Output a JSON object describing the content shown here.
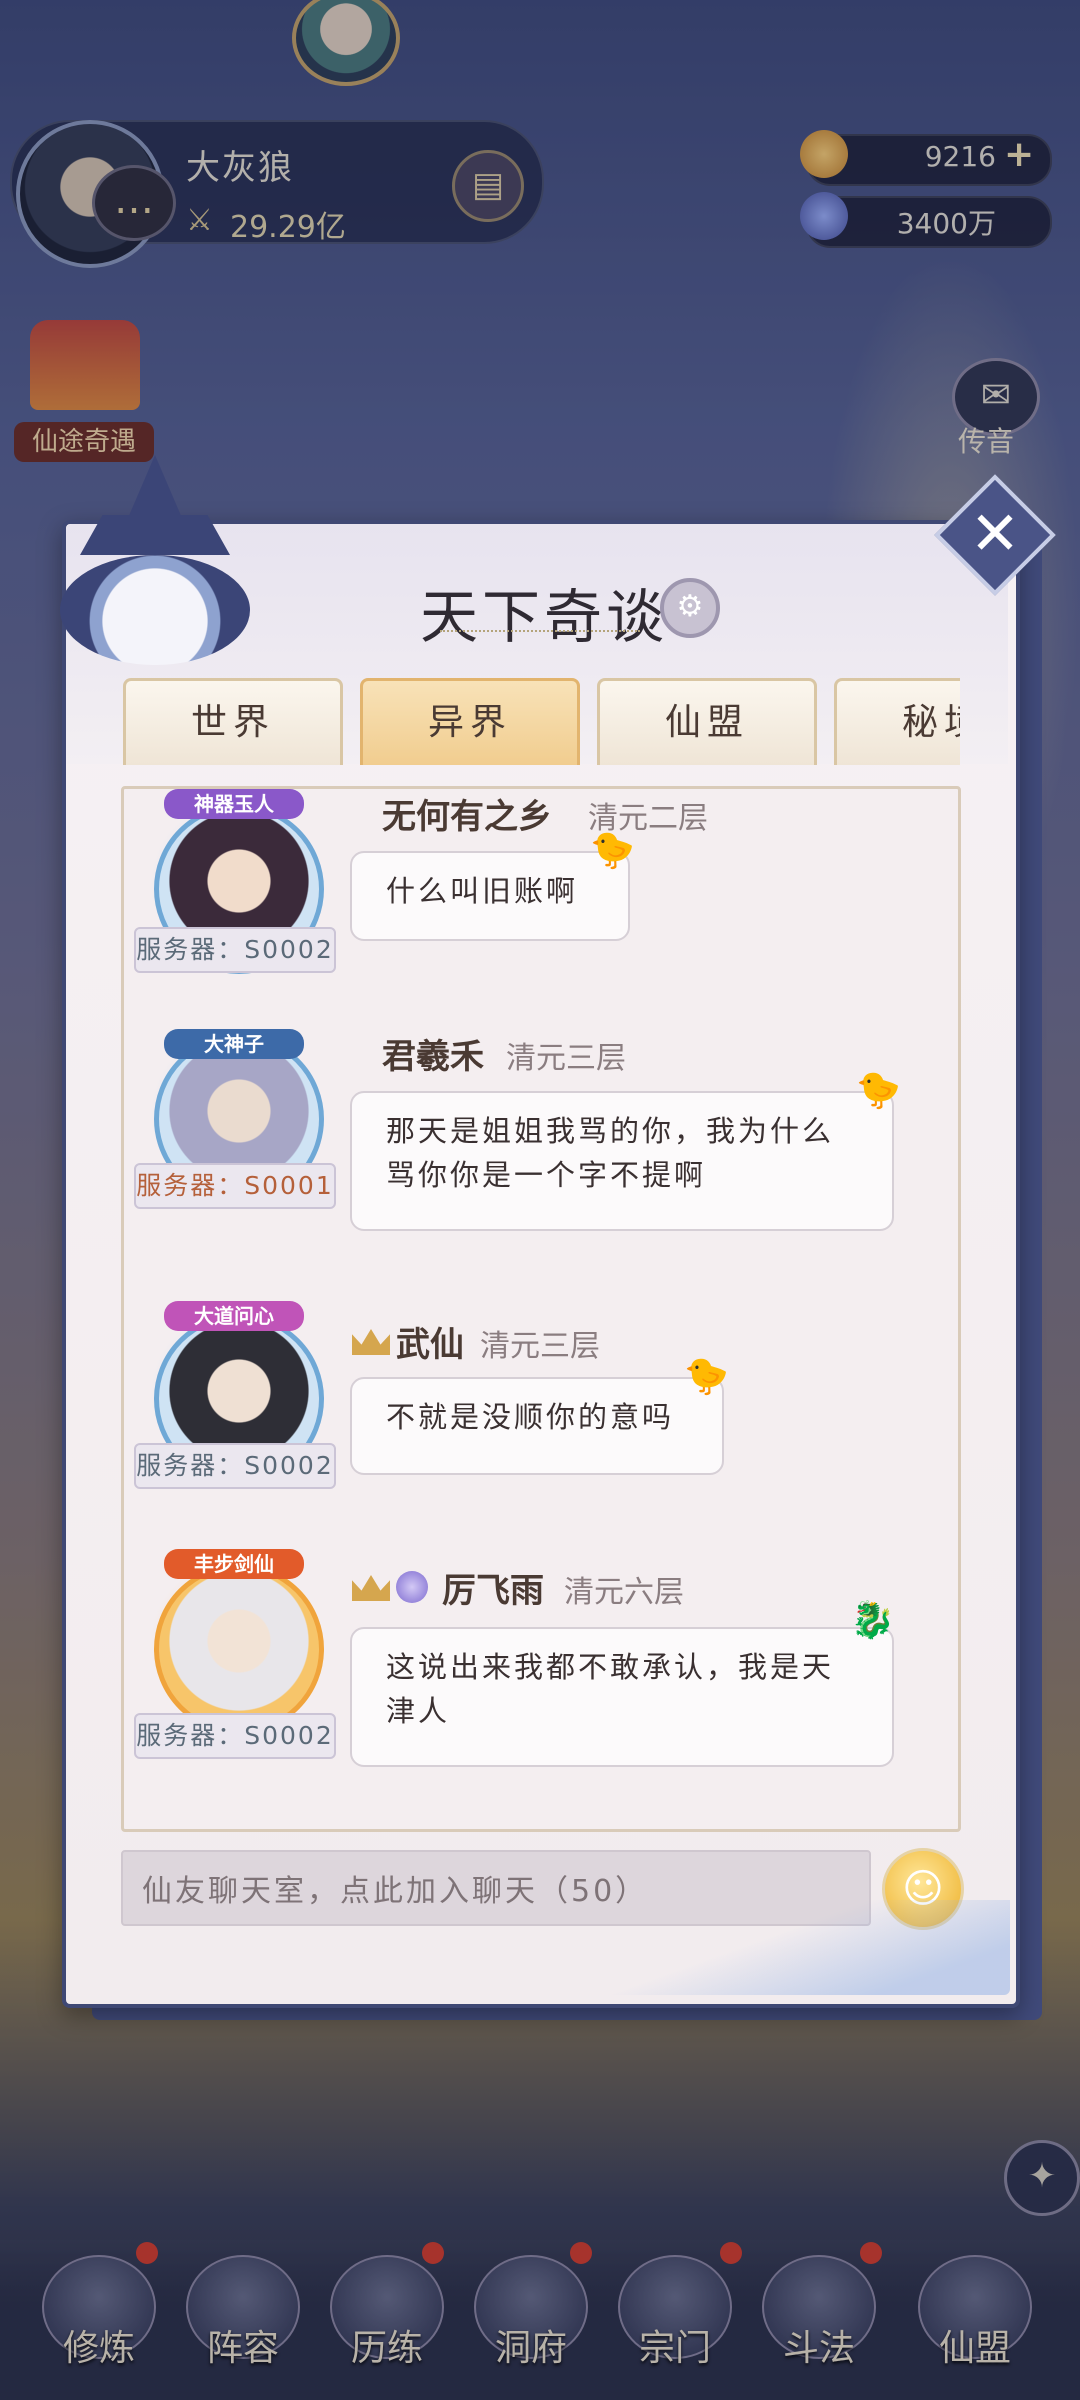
{
  "hud": {
    "player_name": "大灰狼",
    "power_value": "29.29亿",
    "resource_gold": "9216",
    "resource_spirit": "3400万",
    "left_event_label": "仙途奇遇",
    "right_mail_label": "传音"
  },
  "dialog": {
    "title": "天下奇谈",
    "tabs": [
      {
        "label": "世界",
        "active": false
      },
      {
        "label": "异界",
        "active": true
      },
      {
        "label": "仙盟",
        "active": false
      },
      {
        "label": "秘境",
        "active": false
      }
    ],
    "messages": [
      {
        "sender": "无何有之乡",
        "realm": "清元二层",
        "text": "什么叫旧账啊",
        "server": "服务器：S0002",
        "badge": "神器玉人"
      },
      {
        "sender": "君羲禾",
        "realm": "清元三层",
        "text": "那天是姐姐我骂的你，我为什么骂你你是一个字不提啊",
        "server": "服务器：S0001",
        "badge": "大神子"
      },
      {
        "sender": "武仙",
        "realm": "清元三层",
        "text": "不就是没顺你的意吗",
        "server": "服务器：S0002",
        "badge": "大道问心"
      },
      {
        "sender": "厉飞雨",
        "realm": "清元六层",
        "text": "这说出来我都不敢承认，我是天津人",
        "server": "服务器：S0002",
        "badge": "丰步剑仙"
      }
    ],
    "input_placeholder": "仙友聊天室，点此加入聊天（50）"
  },
  "nav": [
    "修炼",
    "阵容",
    "历练",
    "洞府",
    "宗门",
    "斗法",
    "仙盟"
  ],
  "colors": {
    "dialog_border": "#3f4874",
    "tab_active": "#f1cd8f",
    "server_text": "#5b6a78",
    "server_text_alt": "#b5603a"
  },
  "icons": [
    "chat-bubble-icon",
    "sword-power-icon",
    "book-icon",
    "gold-coin-icon",
    "spirit-drop-icon",
    "mail-icon",
    "close-icon",
    "gear-icon",
    "duck-icon",
    "crown-icon",
    "gem-icon",
    "emoji-icon",
    "compass-icon"
  ]
}
